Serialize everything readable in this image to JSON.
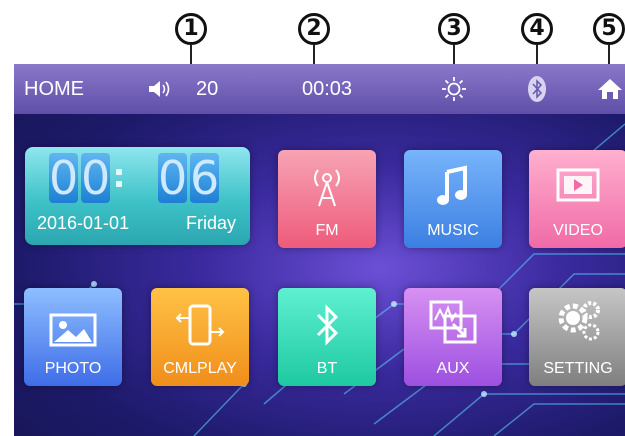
{
  "callouts": [
    "1",
    "2",
    "3",
    "4",
    "5"
  ],
  "statusbar": {
    "title": "HOME",
    "volume_icon": "speaker-icon",
    "volume": "20",
    "time": "00:03",
    "brightness_icon": "sun-icon",
    "bluetooth_icon": "bluetooth-icon",
    "home_icon": "home-icon"
  },
  "clock_widget": {
    "hour_digits": [
      "0",
      "0"
    ],
    "minute_digits": [
      "0",
      "6"
    ],
    "date": "2016-01-01",
    "weekday": "Friday"
  },
  "tiles": [
    {
      "label": "FM",
      "icon": "radio-tower-icon",
      "color": "#ef5f7e"
    },
    {
      "label": "MUSIC",
      "icon": "music-note-icon",
      "color": "#3f86e8"
    },
    {
      "label": "VIDEO",
      "icon": "film-icon",
      "color": "#f26daa"
    },
    {
      "label": "PHOTO",
      "icon": "picture-icon",
      "color": "#4f7bf0"
    },
    {
      "label": "CMLPLAY",
      "icon": "phone-mirror-icon",
      "color": "#f59a22"
    },
    {
      "label": "BT",
      "icon": "bluetooth-icon",
      "color": "#2cd6b0"
    },
    {
      "label": "AUX",
      "icon": "aux-icon",
      "color": "#b75fe0"
    },
    {
      "label": "SETTING",
      "icon": "gears-icon",
      "color": "#8f8f8f"
    }
  ]
}
